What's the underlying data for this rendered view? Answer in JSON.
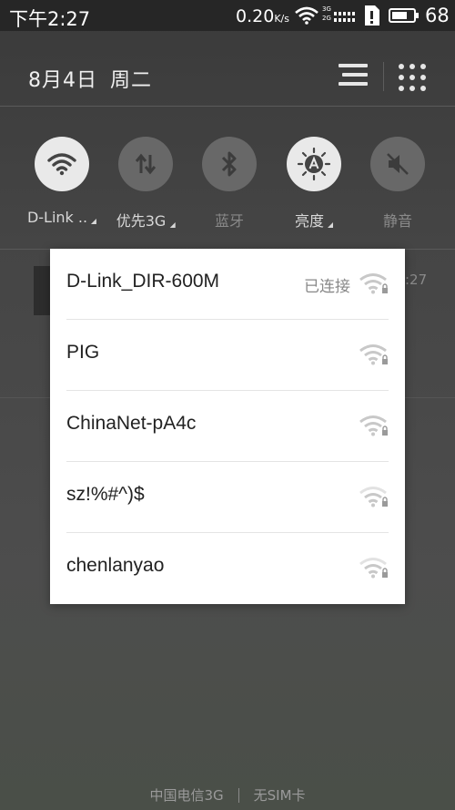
{
  "status_bar": {
    "time": "下午2:27",
    "speed_value": "0.20",
    "speed_unit": "K/s",
    "net_tag_top": "3G",
    "net_tag_bottom": "2G",
    "battery_level": "68",
    "icons": [
      "wifi-icon",
      "signal-icon",
      "sim-card-icon",
      "battery-icon"
    ]
  },
  "header": {
    "date": "8月4日",
    "weekday": "周二",
    "icons": [
      "list-icon",
      "grid-icon"
    ]
  },
  "quick_toggles": [
    {
      "label": "D-Link ..",
      "icon": "wifi-icon",
      "state": "on",
      "has_menu": true
    },
    {
      "label": "优先3G",
      "icon": "data-transfer-icon",
      "state": "off",
      "has_menu": true
    },
    {
      "label": "蓝牙",
      "icon": "bluetooth-icon",
      "state": "off",
      "has_menu": false
    },
    {
      "label": "亮度",
      "icon": "brightness-auto-icon",
      "state": "on",
      "has_menu": true
    },
    {
      "label": "静音",
      "icon": "mute-icon",
      "state": "off",
      "has_menu": false
    }
  ],
  "background": {
    "notification_time_partial": ":27"
  },
  "wifi_popup": {
    "networks": [
      {
        "ssid": "D-Link_DIR-600M",
        "status": "已连接",
        "signal": 3,
        "locked": true
      },
      {
        "ssid": "PIG",
        "status": "",
        "signal": 3,
        "locked": true
      },
      {
        "ssid": "ChinaNet-pA4c",
        "status": "",
        "signal": 3,
        "locked": true
      },
      {
        "ssid": "sz!%#^)$",
        "status": "",
        "signal": 2,
        "locked": true
      },
      {
        "ssid": "chenlanyao",
        "status": "",
        "signal": 2,
        "locked": true
      }
    ]
  },
  "footer": {
    "carrier": "中国电信3G",
    "sim_status": "无SIM卡"
  },
  "colors": {
    "panel_bg": "#454545",
    "toggle_on": "#e9e9e9",
    "toggle_off": "#686868",
    "popup_bg": "#ffffff",
    "signal_gray": "#c8c8c8"
  }
}
